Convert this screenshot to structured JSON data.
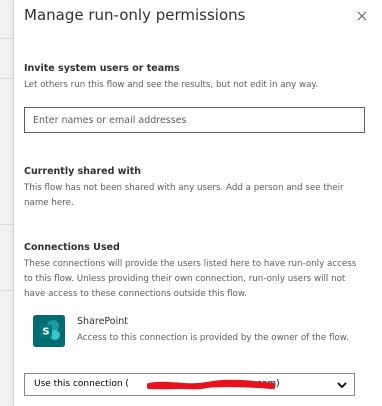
{
  "panel": {
    "title": "Manage run-only permissions",
    "close_icon": "close-icon"
  },
  "invite": {
    "heading": "Invite system users or teams",
    "description": "Let others run this flow and see the results, but not edit in any way.",
    "input_placeholder": "Enter names or email addresses",
    "input_value": ""
  },
  "shared": {
    "heading": "Currently shared with",
    "description": "This flow has not been shared with any users. Add a person and see their name here."
  },
  "connections": {
    "heading": "Connections Used",
    "description": "These connections will provide the users listed here to have run-only access to this flow. Unless providing their own connection, run-only users will not have access to these connections outside this flow.",
    "items": [
      {
        "icon": "sharepoint-icon",
        "icon_letter": "S",
        "icon_color": "#036c70",
        "name": "SharePoint",
        "description": "Access to this connection is provided by the owner of the flow.",
        "select_prefix": "Use this connection (",
        "select_suffix": "com)",
        "select_redaction_color": "#e8121c"
      }
    ]
  }
}
